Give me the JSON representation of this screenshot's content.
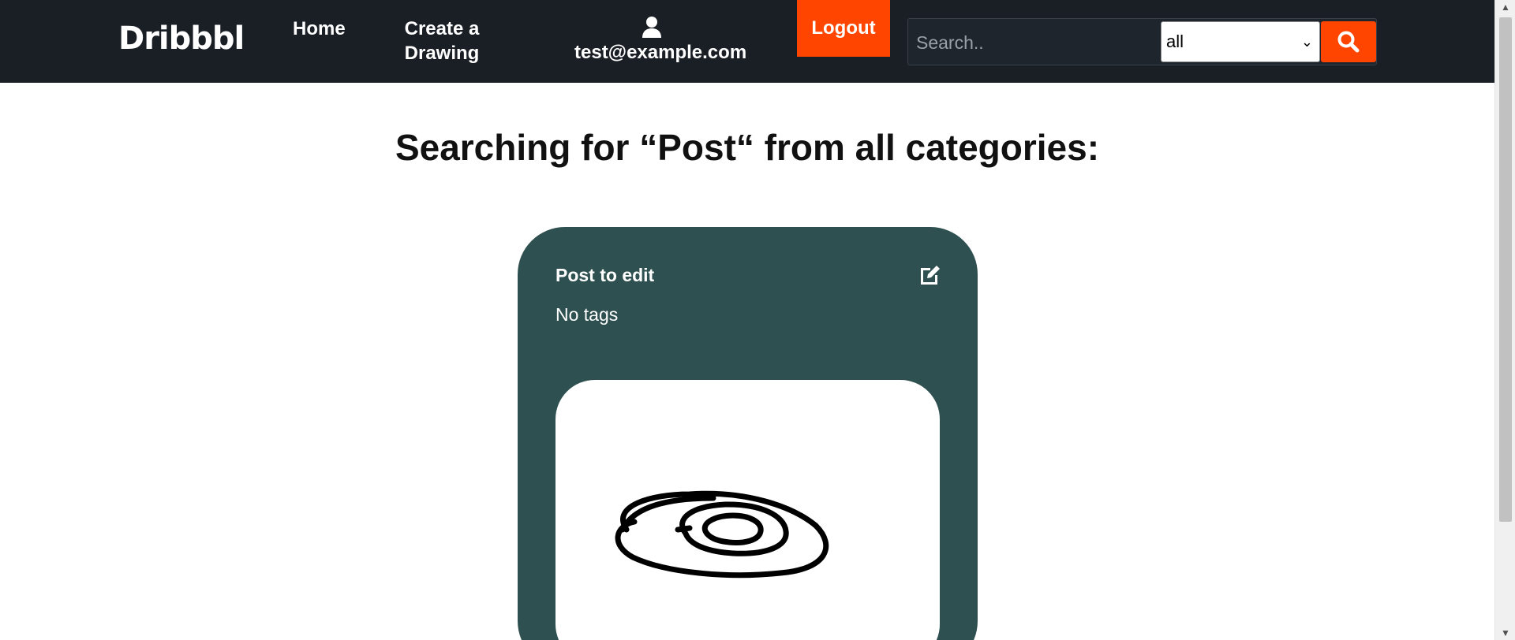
{
  "navbar": {
    "brand": "Dribbbl",
    "home_label": "Home",
    "create_label": "Create a Drawing",
    "user_email": "test@example.com",
    "logout_label": "Logout",
    "search": {
      "placeholder": "Search..",
      "value": ""
    },
    "category_select": {
      "selected": "all"
    },
    "search_button_icon": "magnifier-icon"
  },
  "main": {
    "heading": "Searching for “Post“ from all categories:",
    "results": [
      {
        "title": "Post to edit",
        "tags_text": "No tags",
        "edit_icon": "edit-icon",
        "image": "spiral-drawing"
      }
    ]
  },
  "colors": {
    "navbar_bg": "#1a1f26",
    "accent": "#ff4500",
    "card_bg": "#2f5050"
  }
}
